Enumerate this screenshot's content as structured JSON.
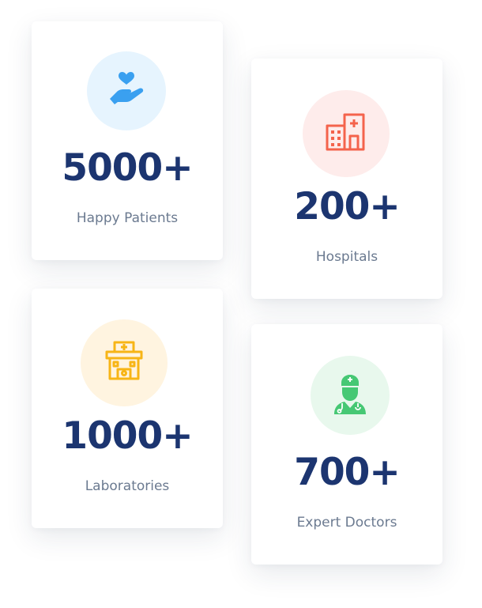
{
  "colors": {
    "value_text": "#1c3570",
    "label_text": "#6b7a90",
    "card_background": "#ffffff"
  },
  "stats": [
    {
      "value": "5000+",
      "label": "Happy Patients",
      "icon": "heart-hand-icon",
      "icon_color": "#3aa0f0",
      "icon_bg": "#e6f4fe"
    },
    {
      "value": "200+",
      "label": "Hospitals",
      "icon": "hospital-building-icon",
      "icon_color": "#f4634c",
      "icon_bg": "#feeceb"
    },
    {
      "value": "1000+",
      "label": "Laboratories",
      "icon": "laboratory-building-icon",
      "icon_color": "#f7b516",
      "icon_bg": "#fff4e0"
    },
    {
      "value": "700+",
      "label": "Expert Doctors",
      "icon": "doctor-icon",
      "icon_color": "#46c874",
      "icon_bg": "#e8f8ed"
    }
  ]
}
